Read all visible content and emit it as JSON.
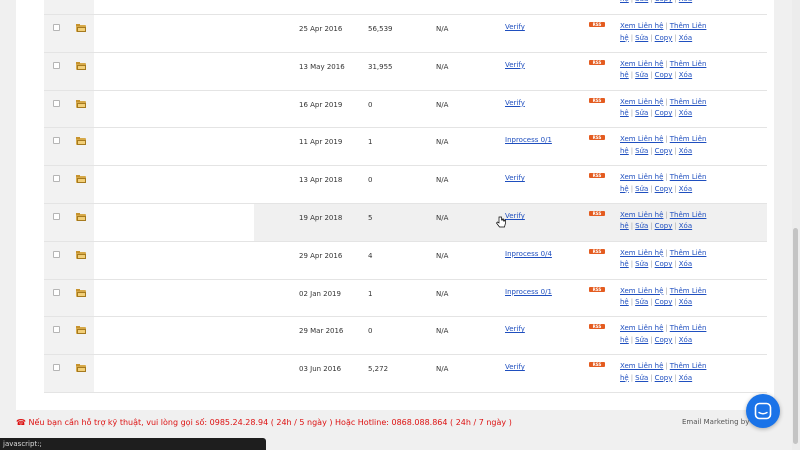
{
  "rows": [
    {
      "date": "",
      "count": "",
      "na": "",
      "status": "",
      "top_partial": true
    },
    {
      "date": "25 Apr 2016",
      "count": "56,539",
      "na": "N/A",
      "status": "Verify"
    },
    {
      "date": "13 May 2016",
      "count": "31,955",
      "na": "N/A",
      "status": "Verify"
    },
    {
      "date": "16 Apr 2019",
      "count": "0",
      "na": "N/A",
      "status": "Verify"
    },
    {
      "date": "11 Apr 2019",
      "count": "1",
      "na": "N/A",
      "status": "Inprocess 0/1"
    },
    {
      "date": "13 Apr 2018",
      "count": "0",
      "na": "N/A",
      "status": "Verify"
    },
    {
      "date": "19 Apr 2018",
      "count": "5",
      "na": "N/A",
      "status": "Verify",
      "highlight": true
    },
    {
      "date": "29 Apr 2016",
      "count": "4",
      "na": "N/A",
      "status": "Inprocess 0/4"
    },
    {
      "date": "02 Jan 2019",
      "count": "1",
      "na": "N/A",
      "status": "Inprocess 0/1"
    },
    {
      "date": "29 Mar 2016",
      "count": "0",
      "na": "N/A",
      "status": "Verify"
    },
    {
      "date": "03 Jun 2016",
      "count": "5,272",
      "na": "N/A",
      "status": "Verify"
    }
  ],
  "actions": {
    "view_contacts": "Xem Liên hệ",
    "add_contact_1": "Thêm Liên",
    "add_contact_2": "hệ",
    "edit": "Sửa",
    "copy": "Copy",
    "delete": "Xóa",
    "sep": "|"
  },
  "rss_label": "RSS",
  "footer": {
    "hotline": "☎ Nếu bạn cần hỗ trợ kỹ thuật, vui lòng gọi số: 0985.24.28.94 ( 24h / 5 ngày ) Hoặc Hotline: 0868.088.864 ( 24h / 7 ngày )",
    "brand": "Email Marketing by Z..."
  },
  "statusbar_text": "javascript:;",
  "colors": {
    "link": "#1f4fbf",
    "rss": "#e45c20",
    "hotline": "#dd1111",
    "chat": "#1a73e8"
  }
}
